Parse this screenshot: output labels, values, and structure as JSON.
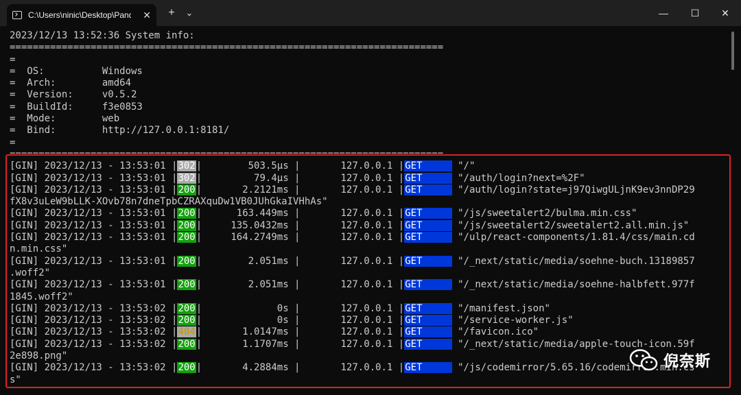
{
  "window": {
    "tab_title": "C:\\Users\\ninic\\Desktop\\Pandora",
    "tab_close": "✕",
    "new_tab": "+",
    "dropdown": "⌄",
    "minimize": "—",
    "maximize": "☐",
    "close": "✕"
  },
  "terminal": {
    "lines": [
      "2023/12/13 13:52:36 System info:",
      "===========================================================================",
      "=",
      "=  OS:          Windows",
      "=  Arch:        amd64",
      "=  Version:     v0.5.2",
      "=  BuildId:     f3e0853",
      "=  Mode:        web",
      "=  Bind:        http://127.0.0.1:8181/",
      "=",
      "==========================================================================="
    ],
    "logs": [
      {
        "ts": "[GIN] 2023/12/13 - 13:53:01 ",
        "status": "302",
        "latency": "        503.5µs |",
        "ip": "       127.0.0.1 ",
        "method": "GET     ",
        "path": " \"/\"",
        "cont": ""
      },
      {
        "ts": "[GIN] 2023/12/13 - 13:53:01 ",
        "status": "302",
        "latency": "         79.4µs |",
        "ip": "       127.0.0.1 ",
        "method": "GET     ",
        "path": " \"/auth/login?next=%2F\"",
        "cont": ""
      },
      {
        "ts": "[GIN] 2023/12/13 - 13:53:01 ",
        "status": "200",
        "latency": "       2.2121ms |",
        "ip": "       127.0.0.1 ",
        "method": "GET     ",
        "path": " \"/auth/login?state=j97QiwgULjnK9ev3nnDP29",
        "cont": "fX8v3uLeW9bLLK-XOvb78n7dneTpbCZRAXquDw1VB0JUhGkaIVHhAs\""
      },
      {
        "ts": "[GIN] 2023/12/13 - 13:53:01 ",
        "status": "200",
        "latency": "      163.449ms |",
        "ip": "       127.0.0.1 ",
        "method": "GET     ",
        "path": " \"/js/sweetalert2/bulma.min.css\"",
        "cont": ""
      },
      {
        "ts": "[GIN] 2023/12/13 - 13:53:01 ",
        "status": "200",
        "latency": "     135.0432ms |",
        "ip": "       127.0.0.1 ",
        "method": "GET     ",
        "path": " \"/js/sweetalert2/sweetalert2.all.min.js\"",
        "cont": ""
      },
      {
        "ts": "[GIN] 2023/12/13 - 13:53:01 ",
        "status": "200",
        "latency": "     164.2749ms |",
        "ip": "       127.0.0.1 ",
        "method": "GET     ",
        "path": " \"/ulp/react-components/1.81.4/css/main.cd",
        "cont": "n.min.css\""
      },
      {
        "ts": "[GIN] 2023/12/13 - 13:53:01 ",
        "status": "200",
        "latency": "        2.051ms |",
        "ip": "       127.0.0.1 ",
        "method": "GET     ",
        "path": " \"/_next/static/media/soehne-buch.13189857",
        "cont": ".woff2\""
      },
      {
        "ts": "[GIN] 2023/12/13 - 13:53:01 ",
        "status": "200",
        "latency": "        2.051ms |",
        "ip": "       127.0.0.1 ",
        "method": "GET     ",
        "path": " \"/_next/static/media/soehne-halbfett.977f",
        "cont": "1845.woff2\""
      },
      {
        "ts": "[GIN] 2023/12/13 - 13:53:02 ",
        "status": "200",
        "latency": "             0s |",
        "ip": "       127.0.0.1 ",
        "method": "GET     ",
        "path": " \"/manifest.json\"",
        "cont": ""
      },
      {
        "ts": "[GIN] 2023/12/13 - 13:53:02 ",
        "status": "200",
        "latency": "             0s |",
        "ip": "       127.0.0.1 ",
        "method": "GET     ",
        "path": " \"/service-worker.js\"",
        "cont": ""
      },
      {
        "ts": "[GIN] 2023/12/13 - 13:53:02 ",
        "status": "404",
        "latency": "       1.0147ms |",
        "ip": "       127.0.0.1 ",
        "method": "GET     ",
        "path": " \"/favicon.ico\"",
        "cont": ""
      },
      {
        "ts": "[GIN] 2023/12/13 - 13:53:02 ",
        "status": "200",
        "latency": "       1.1707ms |",
        "ip": "       127.0.0.1 ",
        "method": "GET     ",
        "path": " \"/_next/static/media/apple-touch-icon.59f",
        "cont": "2e898.png\""
      },
      {
        "ts": "[GIN] 2023/12/13 - 13:53:02 ",
        "status": "200",
        "latency": "       4.2884ms |",
        "ip": "       127.0.0.1 ",
        "method": "GET     ",
        "path": " \"/js/codemirror/5.65.16/codemirror.min.cs",
        "cont": "s\""
      }
    ]
  },
  "watermark": {
    "text": "倪奈斯",
    "icon": "wechat-icon"
  },
  "colors": {
    "status_200": "#13a10e",
    "status_302": "#aaaaaa",
    "status_404": "#c19c00",
    "method_get": "#0037da",
    "highlight_box": "#e02020"
  }
}
